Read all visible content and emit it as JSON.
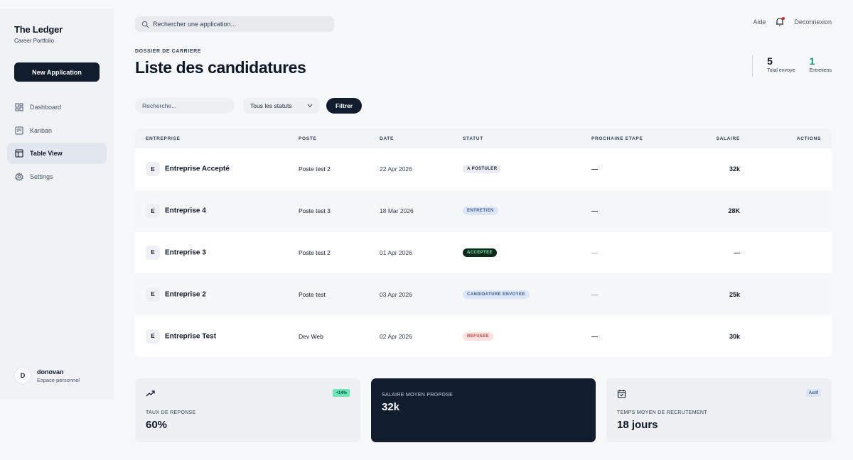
{
  "sidebar": {
    "brand_title": "The Ledger",
    "brand_subtitle": "Career Portfolio",
    "new_button": "New Application",
    "items": [
      {
        "label": "Dashboard",
        "icon": "grid-icon",
        "active": false
      },
      {
        "label": "Kanban",
        "icon": "kanban-icon",
        "active": false
      },
      {
        "label": "Table View",
        "icon": "table-icon",
        "active": true
      },
      {
        "label": "Settings",
        "icon": "gear-icon",
        "active": false
      }
    ],
    "user": {
      "initial": "D",
      "name": "donovan",
      "role": "Espace personnel"
    }
  },
  "topbar": {
    "search_placeholder": "Rechercher une application...",
    "help": "Aide",
    "logout": "Deconnexion"
  },
  "header": {
    "kicker": "DOSSIER DE CARRIERE",
    "title": "Liste des candidatures",
    "stats": [
      {
        "value": "5",
        "label": "Total envoye",
        "color": "#0f172a"
      },
      {
        "value": "1",
        "label": "Entretiens",
        "color": "#059669"
      }
    ]
  },
  "filters": {
    "search_placeholder": "Recherche...",
    "status_value": "Tous les statuts",
    "filter_button": "Filtrer"
  },
  "table": {
    "columns": [
      "ENTREPRISE",
      "POSTE",
      "DATE",
      "STATUT",
      "PROCHAINE ETAPE",
      "SALAIRE",
      "ACTIONS"
    ],
    "rows": [
      {
        "initial": "E",
        "company": "Entreprise Accepté",
        "poste": "Poste test 2",
        "date": "22 Apr 2026",
        "status": "A POSTULER",
        "status_bg": "#e9ebef",
        "status_fg": "#1e293b",
        "next": "—",
        "salary": "32k"
      },
      {
        "initial": "E",
        "company": "Entreprise 4",
        "poste": "Poste test 3",
        "date": "18 Mar 2026",
        "status": "ENTRETIEN",
        "status_bg": "#dbe6f6",
        "status_fg": "#3b5b8a",
        "next": "—",
        "salary": "28K"
      },
      {
        "initial": "E",
        "company": "Entreprise 3",
        "poste": "Poste test 2",
        "date": "01 Apr 2026",
        "status": "ACCEPTEE",
        "status_bg": "#0b2a1c",
        "status_fg": "#7ef0b5",
        "next": "—",
        "salary": "—"
      },
      {
        "initial": "E",
        "company": "Entreprise 2",
        "poste": "Poste test",
        "date": "03 Apr 2026",
        "status": "CANDIDATURE ENVOYEE",
        "status_bg": "#dbe6f6",
        "status_fg": "#3b5b8a",
        "next": "—",
        "salary": "25k"
      },
      {
        "initial": "E",
        "company": "Entreprise Test",
        "poste": "Dev Web",
        "date": "02 Apr 2026",
        "status": "REFUSEE",
        "status_bg": "#fde2e2",
        "status_fg": "#c24141",
        "next": "—",
        "salary": "30k"
      }
    ]
  },
  "cards": [
    {
      "label": "TAUX DE REPONSE",
      "value": "60%",
      "badge": "+14%",
      "icon": "trend-up-icon"
    },
    {
      "label": "SALAIRE MOYEN PROPOSE",
      "value": "32k"
    },
    {
      "label": "TEMPS MOYEN DE RECRUTEMENT",
      "value": "18 jours",
      "badge": "Actif",
      "icon": "calendar-check-icon"
    }
  ]
}
